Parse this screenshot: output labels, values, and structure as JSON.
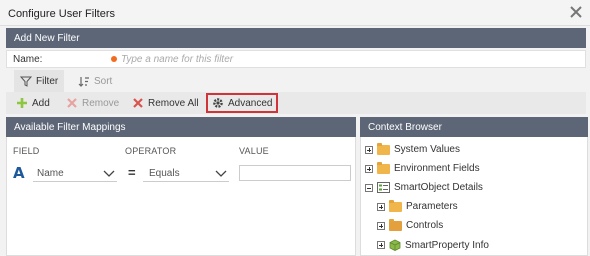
{
  "dialog": {
    "title": "Configure User Filters"
  },
  "add_filter": {
    "header": "Add New Filter",
    "name_label": "Name:",
    "name_placeholder": "Type a name for this filter",
    "name_value": ""
  },
  "tabs": [
    {
      "label": "Filter",
      "active": true
    },
    {
      "label": "Sort",
      "active": false
    }
  ],
  "toolbar": {
    "add": "Add",
    "remove": "Remove",
    "remove_all": "Remove All",
    "advanced": "Advanced"
  },
  "mappings": {
    "header": "Available Filter Mappings",
    "columns": {
      "field": "FIELD",
      "operator": "OPERATOR",
      "value": "VALUE"
    },
    "row": {
      "field": "Name",
      "operator": "Equals",
      "value": ""
    }
  },
  "context": {
    "header": "Context Browser",
    "items": [
      {
        "label": "System Values",
        "expander": "plus",
        "icon": "folder-icon"
      },
      {
        "label": "Environment Fields",
        "expander": "plus",
        "icon": "folder-icon"
      },
      {
        "label": "SmartObject Details",
        "expander": "minus",
        "icon": "smartobject-icon"
      },
      {
        "label": "Parameters",
        "expander": "plus",
        "icon": "folder-icon"
      },
      {
        "label": "Controls",
        "expander": "plus",
        "icon": "folder-gear-icon"
      },
      {
        "label": "SmartProperty Info",
        "expander": "plus",
        "icon": "cube-icon"
      }
    ]
  },
  "colors": {
    "section_header": "#5d6677",
    "highlight_border": "#d13438",
    "required_dot": "#f26b21",
    "add_icon": "#8dc63f",
    "remove_icon": "#d9534f",
    "field_type_icon": "#1e5a9a"
  }
}
